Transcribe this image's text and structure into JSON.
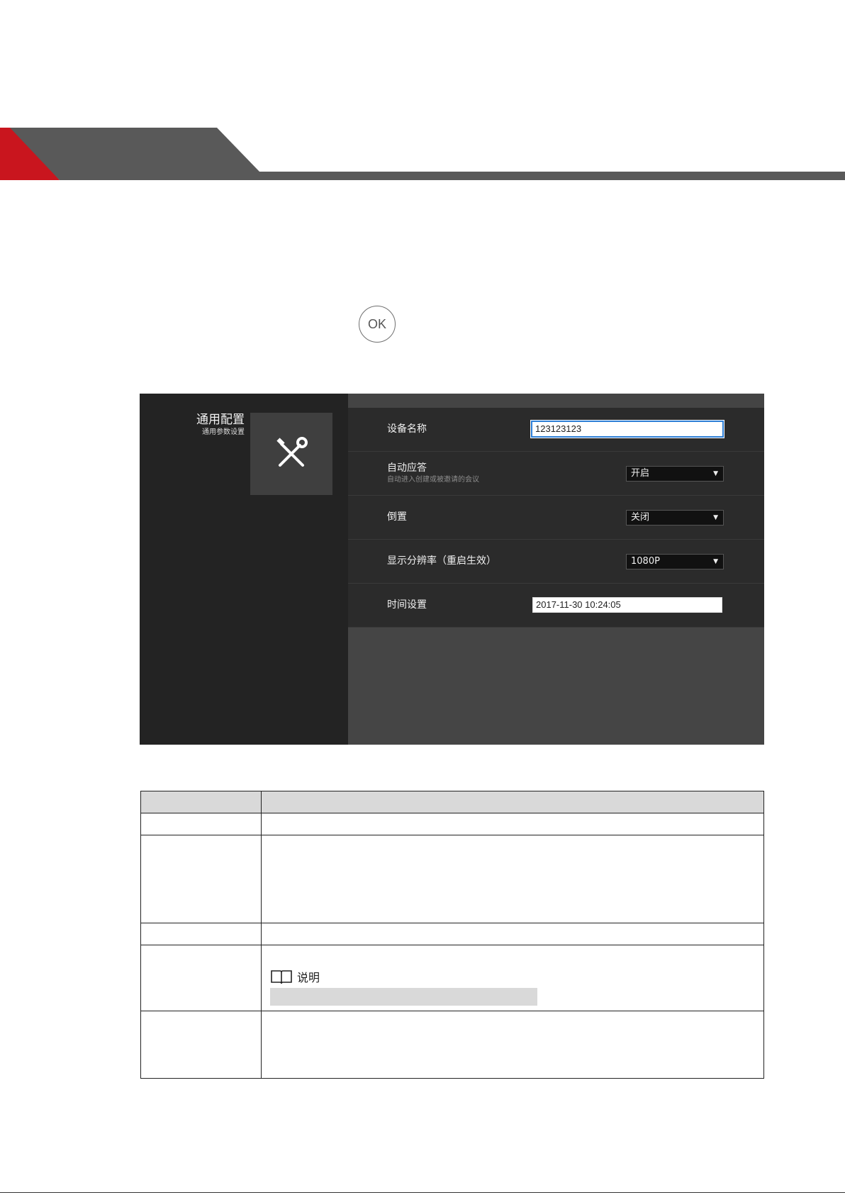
{
  "ok_icon": {
    "label": "OK"
  },
  "device_ui": {
    "sidebar": {
      "title": "通用配置",
      "subtitle": "通用参数设置",
      "icon": "tools-icon"
    },
    "settings": [
      {
        "label": "设备名称",
        "control": "input",
        "value": "123123123"
      },
      {
        "label": "自动应答",
        "sublabel": "自动进入创建或被邀请的会议",
        "control": "select",
        "value": "开启"
      },
      {
        "label": "倒置",
        "control": "select",
        "value": "关闭"
      },
      {
        "label": "显示分辨率（重启生效）",
        "control": "select",
        "value": "1080P"
      },
      {
        "label": "时间设置",
        "control": "input",
        "value": "2017-11-30 10:24:05"
      }
    ]
  },
  "note": {
    "label": "说明",
    "icon": "book-icon"
  },
  "colors": {
    "header_red": "#cc1111",
    "header_gray": "#595959",
    "input_focus": "#2e7fd6"
  }
}
